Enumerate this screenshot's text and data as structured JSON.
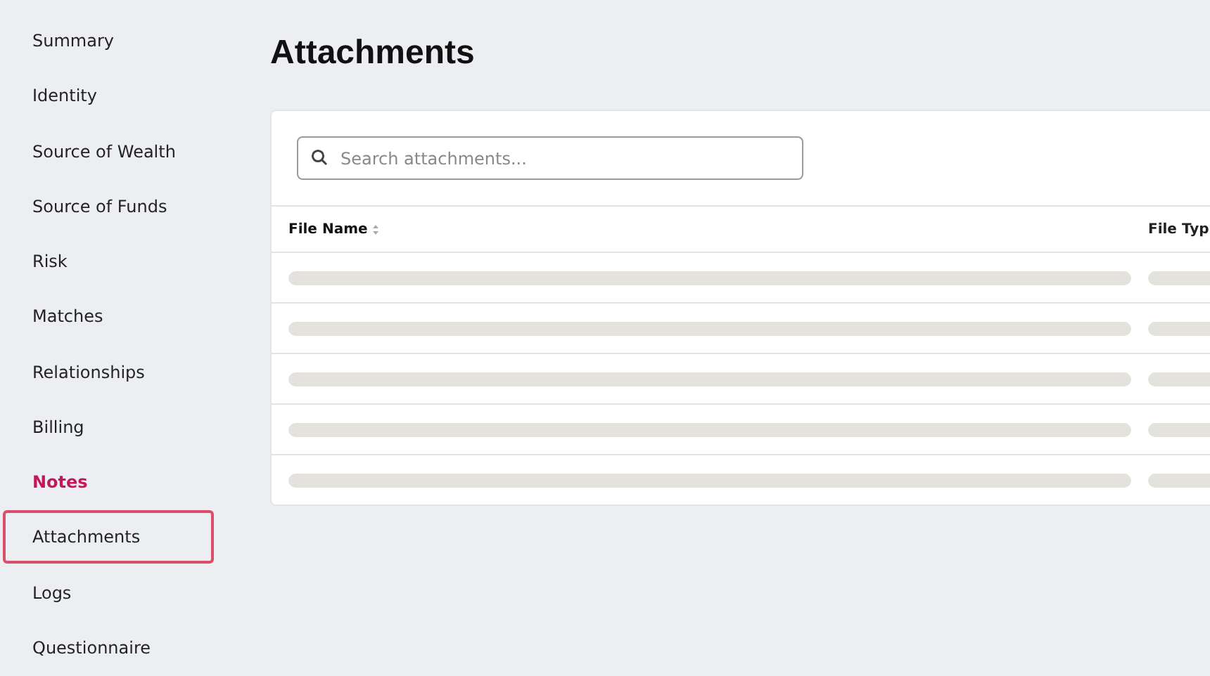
{
  "sidebar": {
    "items": [
      {
        "label": "Summary",
        "selected": false,
        "focused": false
      },
      {
        "label": "Identity",
        "selected": false,
        "focused": false
      },
      {
        "label": "Source of Wealth",
        "selected": false,
        "focused": false
      },
      {
        "label": "Source of Funds",
        "selected": false,
        "focused": false
      },
      {
        "label": "Risk",
        "selected": false,
        "focused": false
      },
      {
        "label": "Matches",
        "selected": false,
        "focused": false
      },
      {
        "label": "Relationships",
        "selected": false,
        "focused": false
      },
      {
        "label": "Billing",
        "selected": false,
        "focused": false
      },
      {
        "label": "Notes",
        "selected": true,
        "focused": false
      },
      {
        "label": "Attachments",
        "selected": false,
        "focused": true
      },
      {
        "label": "Logs",
        "selected": false,
        "focused": false
      },
      {
        "label": "Questionnaire",
        "selected": false,
        "focused": false
      }
    ]
  },
  "page": {
    "title": "Attachments"
  },
  "search": {
    "placeholder": "Search attachments..."
  },
  "table": {
    "columns": [
      {
        "label": "File Name",
        "sortable": true
      },
      {
        "label": "File Typ",
        "sortable": false
      }
    ],
    "rows": [
      {
        "kind": "skeleton"
      },
      {
        "kind": "skeleton"
      },
      {
        "kind": "skeleton"
      },
      {
        "kind": "skeleton"
      },
      {
        "kind": "skeleton"
      }
    ]
  }
}
